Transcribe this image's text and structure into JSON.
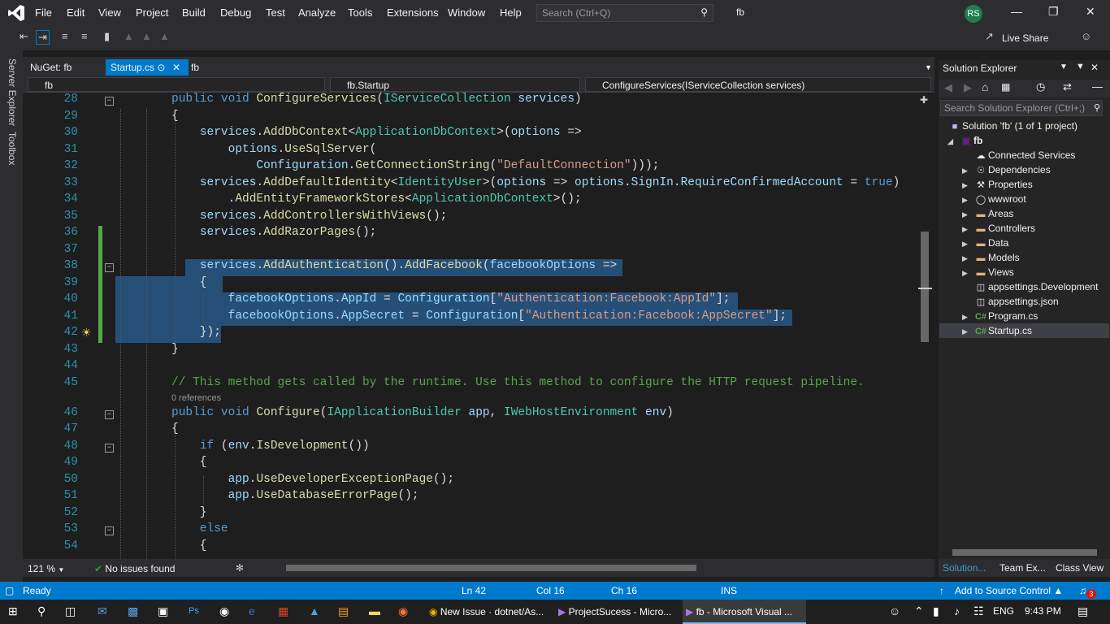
{
  "menu": [
    "File",
    "Edit",
    "View",
    "Project",
    "Build",
    "Debug",
    "Test",
    "Analyze",
    "Tools",
    "Extensions",
    "Window",
    "Help"
  ],
  "search": {
    "placeholder": "Search (Ctrl+Q)"
  },
  "solution_name": "fb",
  "user_initials": "RS",
  "live_share": "Live Share",
  "left_tabs": [
    "Server Explorer",
    "Toolbox"
  ],
  "doc_tabs": [
    {
      "label": "NuGet: fb",
      "active": false
    },
    {
      "label": "Startup.cs",
      "active": true
    },
    {
      "label": "fb",
      "active": false
    }
  ],
  "nav": {
    "project": "fb",
    "class": "fb.Startup",
    "member": "ConfigureServices(IServiceCollection services)"
  },
  "code_lines": [
    {
      "n": "28",
      "t": "public void ConfigureServices(IServiceCollection services)"
    },
    {
      "n": "29",
      "t": "{"
    },
    {
      "n": "30",
      "t": "    services.AddDbContext<ApplicationDbContext>(options =>"
    },
    {
      "n": "31",
      "t": "        options.UseSqlServer("
    },
    {
      "n": "32",
      "t": "            Configuration.GetConnectionString(\"DefaultConnection\")));"
    },
    {
      "n": "33",
      "t": "    services.AddDefaultIdentity<IdentityUser>(options => options.SignIn.RequireConfirmedAccount = true)"
    },
    {
      "n": "34",
      "t": "        .AddEntityFrameworkStores<ApplicationDbContext>();"
    },
    {
      "n": "35",
      "t": "    services.AddControllersWithViews();"
    },
    {
      "n": "36",
      "t": "    services.AddRazorPages();"
    },
    {
      "n": "37",
      "t": ""
    },
    {
      "n": "38",
      "t": "    services.AddAuthentication().AddFacebook(facebookOptions =>"
    },
    {
      "n": "39",
      "t": "    {"
    },
    {
      "n": "40",
      "t": "        facebookOptions.AppId = Configuration[\"Authentication:Facebook:AppId\"];"
    },
    {
      "n": "41",
      "t": "        facebookOptions.AppSecret = Configuration[\"Authentication:Facebook:AppSecret\"];"
    },
    {
      "n": "42",
      "t": "    });"
    },
    {
      "n": "43",
      "t": "}"
    },
    {
      "n": "44",
      "t": ""
    },
    {
      "n": "45",
      "t": "// This method gets called by the runtime. Use this method to configure the HTTP request pipeline."
    },
    {
      "n": "46",
      "t": "public void Configure(IApplicationBuilder app, IWebHostEnvironment env)"
    },
    {
      "n": "47",
      "t": "{"
    },
    {
      "n": "48",
      "t": "    if (env.IsDevelopment())"
    },
    {
      "n": "49",
      "t": "    {"
    },
    {
      "n": "50",
      "t": "        app.UseDeveloperExceptionPage();"
    },
    {
      "n": "51",
      "t": "        app.UseDatabaseErrorPage();"
    },
    {
      "n": "52",
      "t": "    }"
    },
    {
      "n": "53",
      "t": "    else"
    },
    {
      "n": "54",
      "t": "    {"
    }
  ],
  "references_label": "0 references",
  "editor_status": {
    "zoom": "121 %",
    "issues": "No issues found"
  },
  "solution_explorer": {
    "title": "Solution Explorer",
    "search_placeholder": "Search Solution Explorer (Ctrl+;)",
    "items": [
      {
        "label": "Solution 'fb' (1 of 1 project)",
        "icon": "solution-icon"
      },
      {
        "label": "fb",
        "icon": "csharp-project-icon"
      },
      {
        "label": "Connected Services",
        "icon": "connected-services-icon"
      },
      {
        "label": "Dependencies",
        "icon": "dependencies-icon"
      },
      {
        "label": "Properties",
        "icon": "wrench-icon"
      },
      {
        "label": "wwwroot",
        "icon": "globe-icon"
      },
      {
        "label": "Areas",
        "icon": "folder-icon"
      },
      {
        "label": "Controllers",
        "icon": "folder-icon"
      },
      {
        "label": "Data",
        "icon": "folder-icon"
      },
      {
        "label": "Models",
        "icon": "folder-icon"
      },
      {
        "label": "Views",
        "icon": "folder-icon"
      },
      {
        "label": "appsettings.Development",
        "icon": "json-file-icon"
      },
      {
        "label": "appsettings.json",
        "icon": "json-file-icon"
      },
      {
        "label": "Program.cs",
        "icon": "csharp-file-icon"
      },
      {
        "label": "Startup.cs",
        "icon": "csharp-file-icon"
      }
    ],
    "tabs": [
      "Solution...",
      "Team Ex...",
      "Class View"
    ]
  },
  "status": {
    "ready": "Ready",
    "ln": "Ln 42",
    "col": "Col 16",
    "ch": "Ch 16",
    "mode": "INS",
    "source_control": "Add to Source Control",
    "notifications": "3"
  },
  "taskbar": {
    "apps": [
      "New Issue · dotnet/As...",
      "ProjectSucess - Micro...",
      "fb - Microsoft Visual ..."
    ],
    "lang": "ENG",
    "time": "9:43 PM"
  },
  "colors": {
    "accent": "#007acc",
    "chrome": "#2d2d30",
    "editor": "#1e1e1e",
    "selection": "#264f78"
  }
}
